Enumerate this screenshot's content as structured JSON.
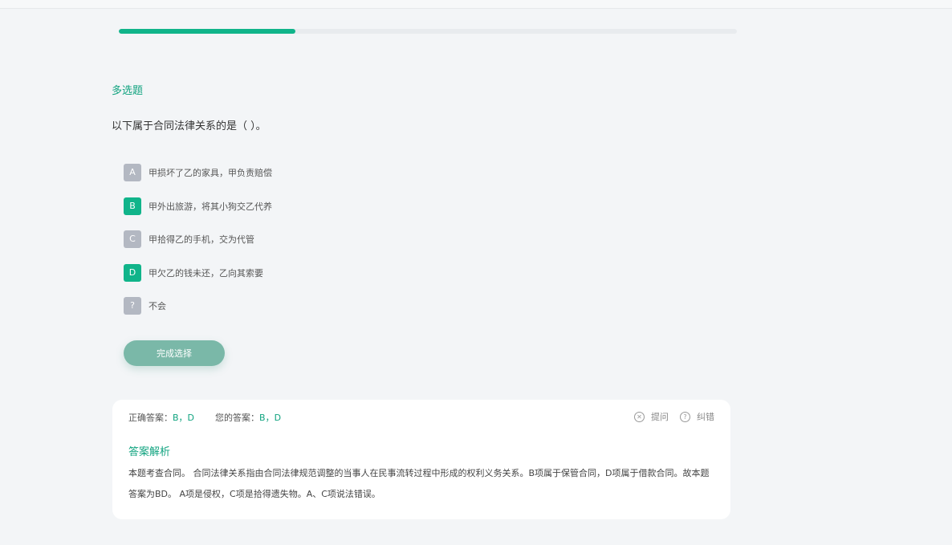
{
  "progress": {
    "fraction": 0.286
  },
  "question": {
    "type_label": "多选题",
    "stem": "以下属于合同法律关系的是（ ）。",
    "options": [
      {
        "key": "A",
        "text": "甲损坏了乙的家具，甲负责赔偿",
        "selected": false
      },
      {
        "key": "B",
        "text": "甲外出旅游，将其小狗交乙代养",
        "selected": true
      },
      {
        "key": "C",
        "text": "甲拾得乙的手机，交为代管",
        "selected": false
      },
      {
        "key": "D",
        "text": "甲欠乙的钱未还，乙向其索要",
        "selected": true
      },
      {
        "key": "?",
        "text": "不会",
        "selected": false
      }
    ],
    "submit_label": "完成选择"
  },
  "answer": {
    "correct_label": "正确答案：",
    "correct_value": "B，D",
    "yours_label": "您的答案：",
    "yours_value": "B，D",
    "ask_label": "提问",
    "report_label": "纠错",
    "ask_icon": "x-circle-icon",
    "report_icon": "question-circle-icon",
    "analysis_title": "答案解析",
    "analysis_text": "本题考查合同。 合同法律关系指由合同法律规范调整的当事人在民事流转过程中形成的权利义务关系。B项属于保管合同，D项属于借款合同。故本题答案为BD。 A项是侵权，C项是拾得遗失物。A、C项说法错误。"
  },
  "colors": {
    "accent": "#10b48a",
    "unselected": "#b3b8c2",
    "button": "#7ab8a8"
  }
}
